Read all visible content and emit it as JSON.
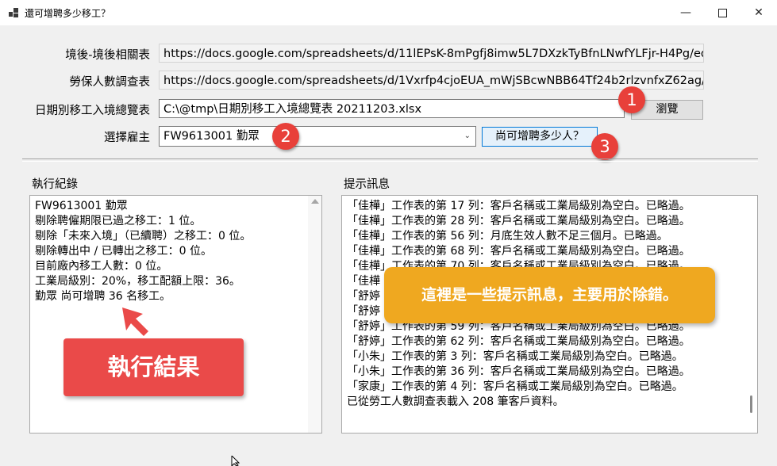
{
  "window": {
    "title": "還可增聘多少移工？",
    "minimize_icon": "minimize-icon",
    "maximize_icon": "maximize-icon",
    "close_icon": "close-icon"
  },
  "form": {
    "label_1": "境後-境後相關表",
    "value_1": "https://docs.google.com/spreadsheets/d/11lEPsK-8mPgfj8imw5L7DXzkTyBfnLNwfYLFjr-H4Pg/ed",
    "label_2": "勞保人數調查表",
    "value_2": "https://docs.google.com/spreadsheets/d/1Vxrfp4cjoEUA_mWjSBcwNBB64Tf24b2rlzvnfxZ62ag/",
    "label_3": "日期別移工入境總覽表",
    "value_3": "C:\\@tmp\\日期別移工入境總覽表 20211203.xlsx",
    "browse_button": "瀏覽",
    "employer_label": "選擇雇主",
    "employer_selected": "FW9613001 勤眾",
    "query_button": "尚可增聘多少人？"
  },
  "badges": [
    "1",
    "2",
    "3"
  ],
  "log": {
    "title": "執行紀錄",
    "lines": [
      "FW9613001 勤眾",
      "剔除聘僱期限已過之移工：1 位。",
      "剔除「未來入境」（已續聘）之移工：0 位。",
      "剔除轉出中 / 已轉出之移工：0 位。",
      "目前廠內移工人數：0 位。",
      "工業局級別：20%，移工配額上限：36。",
      "勤眾 尚可增聘 36 名移工。"
    ]
  },
  "hints": {
    "title": "提示訊息",
    "lines": [
      "「佳樺」工作表的第 17 列：客戶名稱或工業局級別為空白。已略過。",
      "「佳樺」工作表的第 28 列：客戶名稱或工業局級別為空白。已略過。",
      "「佳樺」工作表的第 56 列：月底生效人數不足三個月。已略過。",
      "「佳樺」工作表的第 68 列：客戶名稱或工業局級別為空白。已略過。",
      "「佳樺」工作表的第 70 列：客戶名稱或工業局級別為空白。已略過。",
      "「佳樺",
      "「舒婷",
      "「舒婷",
      "「舒婷」工作表的第 59 列：客戶名稱或工業局級別為空白。已略過。",
      "「舒婷」工作表的第 62 列：客戶名稱或工業局級別為空白。已略過。",
      "「小朱」工作表的第 3 列：客戶名稱或工業局級別為空白。已略過。",
      "「小朱」工作表的第 36 列：客戶名稱或工業局級別為空白。已略過。",
      "「家康」工作表的第 4 列：客戶名稱或工業局級別為空白。已略過。",
      "已從勞工人數調查表載入 208 筆客戶資料。"
    ]
  },
  "annotations": {
    "result_label": "執行結果",
    "hint_label": "這裡是一些提示訊息，主要用於除錯。"
  },
  "colors": {
    "badge": "#e8403a",
    "result_callout": "#ea4a49",
    "hint_callout": "#efa820",
    "focus_border": "#0078d7"
  }
}
